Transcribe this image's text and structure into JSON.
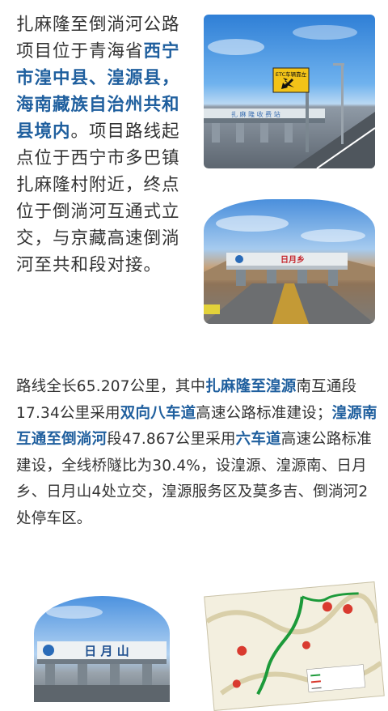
{
  "para1": [
    {
      "t": "扎麻隆至倒淌河公路项目位于青海省",
      "hl": false
    },
    {
      "t": "西宁市湟中县、湟源县，海南藏族自治州共和县境内",
      "hl": true
    },
    {
      "t": "。项目路线起点位于西宁市多巴镇扎麻隆村附近，终点位于倒淌河互通式立交，与京藏高速倒淌河至共和段对接。",
      "hl": false
    }
  ],
  "para2": [
    {
      "t": "路线全长65.207公里，其中",
      "hl": false
    },
    {
      "t": "扎麻隆至湟源",
      "hl": true
    },
    {
      "t": "南互通段17.34公里采用",
      "hl": false
    },
    {
      "t": "双向八车道",
      "hl": true
    },
    {
      "t": "高速公路标准建设；",
      "hl": false
    },
    {
      "t": "湟源南互通至倒淌河",
      "hl": true
    },
    {
      "t": "段47.867公里采用",
      "hl": false
    },
    {
      "t": "六车道",
      "hl": true
    },
    {
      "t": "高速公路标准建设，全线桥隧比为30.4%，设湟源、湟源南、日月乡、日月山4处立交，湟源服务区及莫多吉、倒淌河2处停车区。",
      "hl": false
    }
  ],
  "photo1": {
    "sign": "ETC车辆靠左"
  },
  "photo2": {
    "sign": "日月乡"
  },
  "photo3": {
    "sign": "日 月 山"
  },
  "colors": {
    "highlight": "#1f5f9e",
    "text": "#333333"
  }
}
